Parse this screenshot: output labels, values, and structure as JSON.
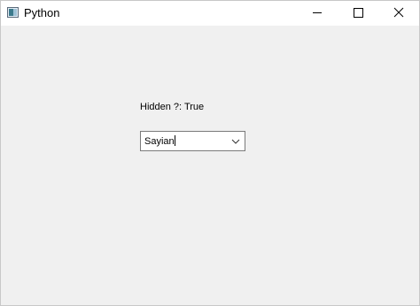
{
  "window": {
    "title": "Python",
    "icon": "python-app-icon",
    "controls": {
      "minimize_icon": "minimize-icon",
      "maximize_icon": "maximize-icon",
      "close_icon": "close-icon"
    }
  },
  "main": {
    "status_label": "Hidden ?: True",
    "combo": {
      "value": "Sayian",
      "arrow_icon": "chevron-down-icon"
    }
  },
  "colors": {
    "titlebar": "#ffffff",
    "client_background": "#f0f0f0",
    "combo_border": "#7a7a7a"
  }
}
